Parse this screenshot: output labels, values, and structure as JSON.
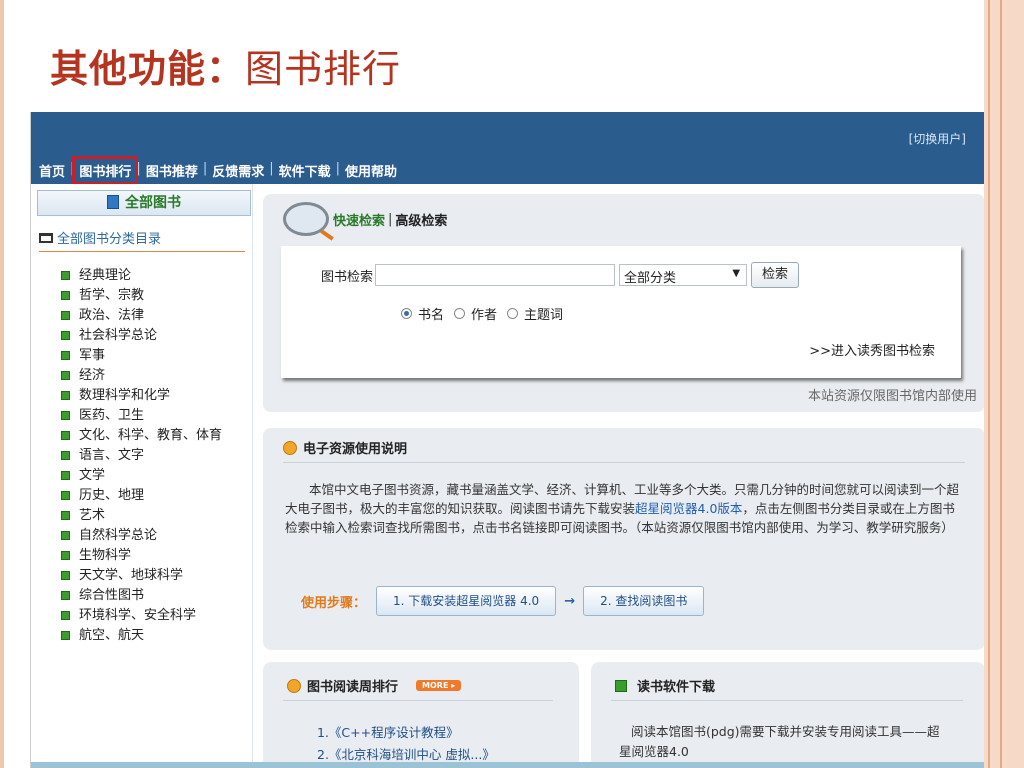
{
  "slide": {
    "title_main": "其他功能：",
    "title_sub": "图书排行"
  },
  "header": {
    "switch_user": "[切换用户]",
    "nav": [
      "首页",
      "图书排行",
      "图书推荐",
      "反馈需求",
      "软件下载",
      "使用帮助"
    ],
    "nav_separator": "|",
    "active_nav": "图书排行"
  },
  "sidebar": {
    "heading": "全部图书",
    "category_dir": "全部图书分类目录",
    "categories": [
      "经典理论",
      "哲学、宗教",
      "政治、法律",
      "社会科学总论",
      "军事",
      "经济",
      "数理科学和化学",
      "医药、卫生",
      "文化、科学、教育、体育",
      "语言、文字",
      "文学",
      "历史、地理",
      "艺术",
      "自然科学总论",
      "生物科学",
      "天文学、地球科学",
      "综合性图书",
      "环境科学、安全科学",
      "航空、航天"
    ]
  },
  "search": {
    "tab_quick": "快速检索",
    "tab_separator": "|",
    "tab_advanced": "高级检索",
    "label": "图书检索",
    "input_value": "",
    "category_selected": "全部分类",
    "button": "检索",
    "radio_options": [
      "书名",
      "作者",
      "主题词"
    ],
    "radio_selected": "书名",
    "enter_link": ">>进入读秀图书检索",
    "notice": "本站资源仅限图书馆内部使用"
  },
  "info": {
    "heading": "电子资源使用说明",
    "text_part1": "本馆中文电子图书资源，藏书量涵盖文学、经济、计算机、工业等多个大类。只需几分钟的时间您就可以阅读到一个超大电子图书，极大的丰富您的知识获取。阅读图书请先下载安装",
    "text_link": "超星阅览器4.0版本",
    "text_part2": "，点击左侧图书分类目录或在上方图书检索中输入检索词查找所需图书，点击书名链接即可阅读图书。（本站资源仅限图书馆内部使用、为学习、教学研究服务）",
    "steps_label": "使用步骤：",
    "step1": "1. 下载安装超星阅览器 4.0",
    "step2": "2. 查找阅读图书",
    "arrow": "→"
  },
  "weekly_rank": {
    "heading": "图书阅读周排行",
    "more": "MORE ▸",
    "items": [
      "1.《C++程序设计教程》",
      "2.《北京科海培训中心 虚拟...》"
    ]
  },
  "software": {
    "heading": "读书软件下载",
    "text": "阅读本馆图书(pdg)需要下载并安装专用阅读工具——超星阅览器4.0"
  }
}
